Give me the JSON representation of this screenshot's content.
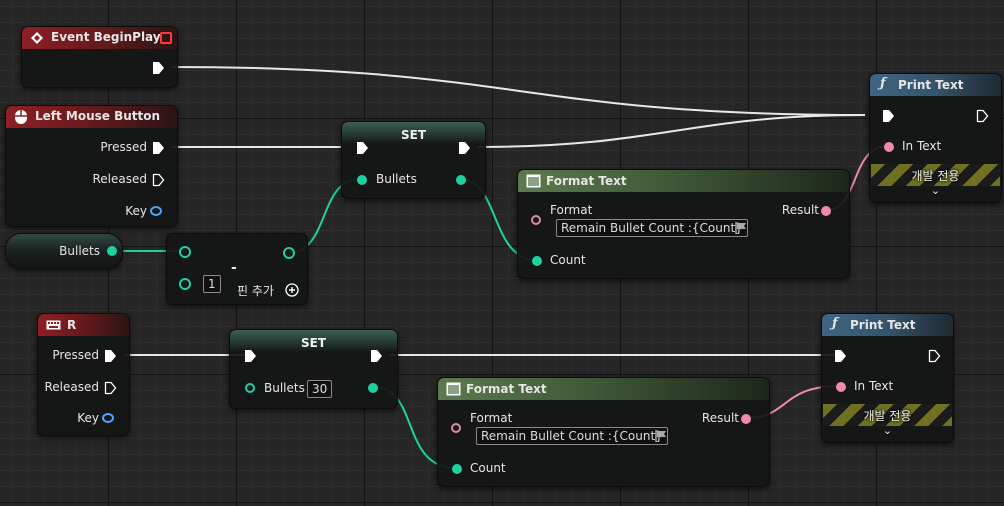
{
  "nodes": {
    "begin_play": {
      "title": "Event BeginPlay"
    },
    "left_mouse": {
      "title": "Left Mouse Button",
      "pressed": "Pressed",
      "released": "Released",
      "key": "Key"
    },
    "bullets_get": {
      "label": "Bullets"
    },
    "subtract": {
      "op": "-",
      "value": "1",
      "add_pin": "핀 추가"
    },
    "set1": {
      "title": "SET",
      "var": "Bullets"
    },
    "format1": {
      "title": "Format Text",
      "format_label": "Format",
      "format_value": "Remain Bullet Count :{Count}",
      "result": "Result",
      "count": "Count"
    },
    "print1": {
      "title": "Print Text",
      "in_text": "In Text",
      "dev_only": "개발 전용"
    },
    "r_key": {
      "title": "R",
      "pressed": "Pressed",
      "released": "Released",
      "key": "Key"
    },
    "set2": {
      "title": "SET",
      "var": "Bullets",
      "value": "30"
    },
    "format2": {
      "title": "Format Text",
      "format_label": "Format",
      "format_value": "Remain Bullet Count :{Count}",
      "result": "Result",
      "count": "Count"
    },
    "print2": {
      "title": "Print Text",
      "in_text": "In Text",
      "dev_only": "개발 전용"
    }
  },
  "icons": {
    "event": "diamond-event-icon",
    "mouse": "mouse-icon",
    "keyboard": "keyboard-icon",
    "function": "function-f-icon",
    "format": "format-text-icon",
    "flag": "flag-icon",
    "add": "plus-circle-icon",
    "collapse": "chevron-down-icon"
  },
  "colors": {
    "exec": "#ffffff",
    "integer_pin": "#1fd1a0",
    "text_pin": "#f08aa6",
    "struct_pin": "#4aa5ff",
    "event_header": "#8e1f24",
    "function_header": "#3f6582",
    "pure_header": "#5c7a4d",
    "dev_only_stripe": "#6f7020"
  }
}
